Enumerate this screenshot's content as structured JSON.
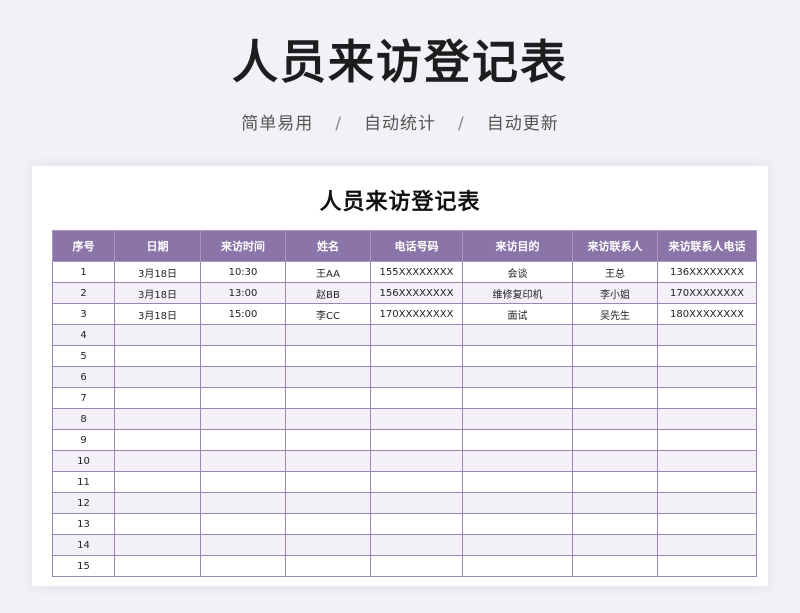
{
  "hero": {
    "title": "人员来访登记表",
    "features": [
      "简单易用",
      "自动统计",
      "自动更新"
    ],
    "separator": "/"
  },
  "sheet": {
    "title": "人员来访登记表",
    "columns": [
      "序号",
      "日期",
      "来访时间",
      "姓名",
      "电话号码",
      "来访目的",
      "来访联系人",
      "来访联系人电话"
    ],
    "rows": [
      [
        "1",
        "3月18日",
        "10:30",
        "王AA",
        "155XXXXXXXX",
        "会谈",
        "王总",
        "136XXXXXXXX"
      ],
      [
        "2",
        "3月18日",
        "13:00",
        "赵BB",
        "156XXXXXXXX",
        "维修复印机",
        "李小姐",
        "170XXXXXXXX"
      ],
      [
        "3",
        "3月18日",
        "15:00",
        "李CC",
        "170XXXXXXXX",
        "面试",
        "吴先生",
        "180XXXXXXXX"
      ],
      [
        "4",
        "",
        "",
        "",
        "",
        "",
        "",
        ""
      ],
      [
        "5",
        "",
        "",
        "",
        "",
        "",
        "",
        ""
      ],
      [
        "6",
        "",
        "",
        "",
        "",
        "",
        "",
        ""
      ],
      [
        "7",
        "",
        "",
        "",
        "",
        "",
        "",
        ""
      ],
      [
        "8",
        "",
        "",
        "",
        "",
        "",
        "",
        ""
      ],
      [
        "9",
        "",
        "",
        "",
        "",
        "",
        "",
        ""
      ],
      [
        "10",
        "",
        "",
        "",
        "",
        "",
        "",
        ""
      ],
      [
        "11",
        "",
        "",
        "",
        "",
        "",
        "",
        ""
      ],
      [
        "12",
        "",
        "",
        "",
        "",
        "",
        "",
        ""
      ],
      [
        "13",
        "",
        "",
        "",
        "",
        "",
        "",
        ""
      ],
      [
        "14",
        "",
        "",
        "",
        "",
        "",
        "",
        ""
      ],
      [
        "15",
        "",
        "",
        "",
        "",
        "",
        "",
        ""
      ]
    ]
  },
  "colors": {
    "header_bg": "#8b74a8",
    "row_alt_bg": "#f3f0f7",
    "border": "#9a86b3"
  }
}
